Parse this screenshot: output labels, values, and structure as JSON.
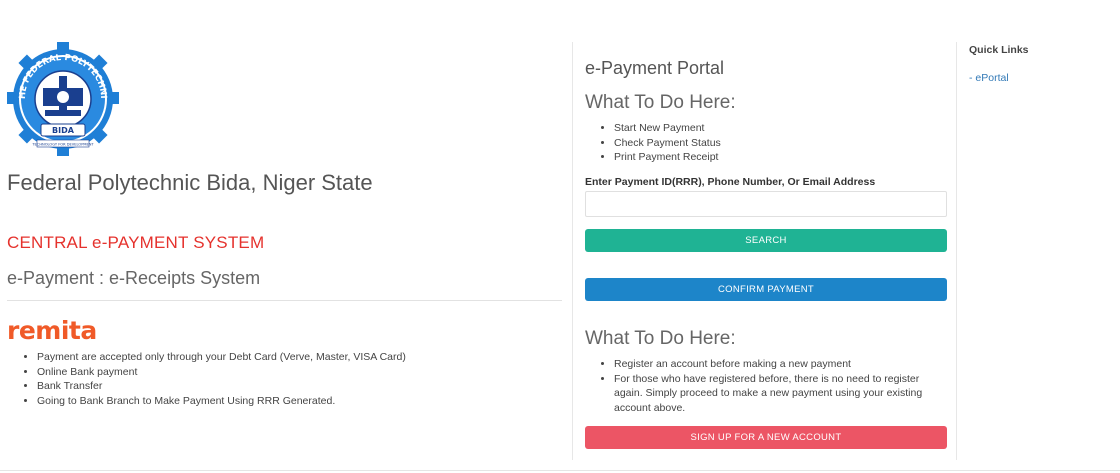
{
  "logo": {
    "ring_text_top": "THE FEDERAL POLYTECHNIC",
    "ring_text_bottom": "BIDA",
    "motto": "TECHNOLOGY FOR DEVELOPMENT",
    "colors": {
      "blue": "#1f7fd6",
      "dark_blue": "#1a3f8f"
    }
  },
  "institution_name": "Federal Polytechnic Bida, Niger State",
  "system_title": "CENTRAL e-PAYMENT SYSTEM",
  "system_subtitle": "e-Payment : e-Receipts System",
  "remita": {
    "brand": "remita",
    "color": "#f05a28"
  },
  "payment_methods": [
    "Payment are accepted only through your Debt Card (Verve, Master, VISA Card)",
    "Online Bank payment",
    "Bank Transfer",
    "Going to Bank Branch to Make Payment Using RRR Generated."
  ],
  "portal": {
    "title": "e-Payment Portal",
    "section1_heading": "What To Do Here:",
    "section1_items": [
      "Start New Payment",
      "Check Payment Status",
      "Print Payment Receipt"
    ],
    "search_label": "Enter Payment ID(RRR), Phone Number, Or Email Address",
    "search_value": "",
    "search_button": "SEARCH",
    "confirm_button": "CONFIRM PAYMENT",
    "section2_heading": "What To Do Here:",
    "section2_items": [
      "Register an account before making a new payment",
      "For those who have registered before, there is no need to register again. Simply proceed to make a new payment using your existing account above."
    ],
    "signup_button": "SIGN UP FOR A NEW ACCOUNT",
    "colors": {
      "search": "#1fb394",
      "confirm": "#1d85c9",
      "signup": "#ec5565"
    }
  },
  "quick_links": {
    "title": "Quick Links",
    "items": [
      "- ePortal"
    ]
  }
}
